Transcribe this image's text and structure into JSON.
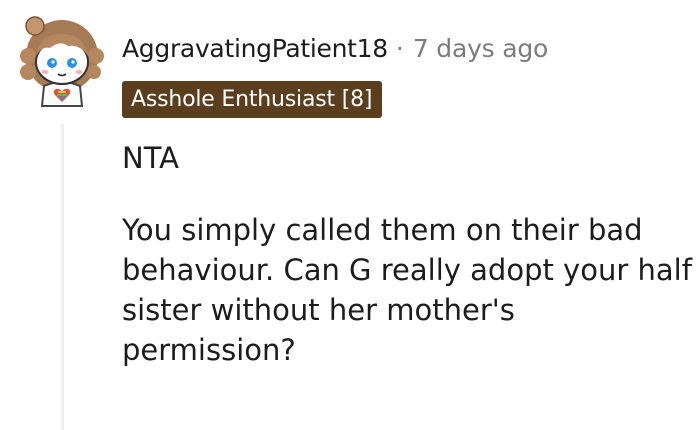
{
  "comment": {
    "author": "AggravatingPatient18",
    "separator": "·",
    "timestamp": "7 days ago",
    "flair": "Asshole Enthusiast [8]",
    "flair_color": "#5a3e1e",
    "avatar_icon": "snoo-avatar-icon",
    "paragraphs": [
      "NTA",
      "You simply called them on their bad behaviour. Can G really adopt your half sister without her mother's permission?"
    ]
  }
}
